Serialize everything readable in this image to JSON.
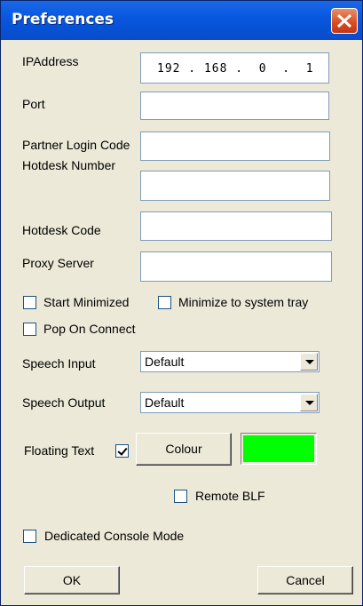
{
  "window": {
    "title": "Preferences"
  },
  "fields": {
    "ip_label": "IPAddress",
    "ip_value": "192 . 168 .  0  .  1",
    "port_label": "Port",
    "port_value": "",
    "partner_label": "Partner Login Code",
    "partner_value": "",
    "hotdesk_number_label": "Hotdesk Number",
    "hotdesk_number_value": "",
    "hotdesk_code_label": "Hotdesk Code",
    "hotdesk_code_value": "",
    "proxy_label": "Proxy Server",
    "proxy_value": ""
  },
  "options": {
    "start_minimized": {
      "label": "Start Minimized",
      "checked": false
    },
    "minimize_tray": {
      "label": "Minimize to system tray",
      "checked": false
    },
    "pop_on_connect": {
      "label": "Pop On Connect",
      "checked": false
    },
    "floating_text": {
      "label": "Floating Text",
      "checked": true
    },
    "remote_blf": {
      "label": "Remote BLF",
      "checked": false
    },
    "dedicated_console": {
      "label": "Dedicated Console Mode",
      "checked": false
    }
  },
  "speech": {
    "input_label": "Speech Input",
    "input_value": "Default",
    "output_label": "Speech Output",
    "output_value": "Default"
  },
  "colour": {
    "button_label": "Colour",
    "swatch": "#00ff00"
  },
  "buttons": {
    "ok": "OK",
    "cancel": "Cancel"
  }
}
